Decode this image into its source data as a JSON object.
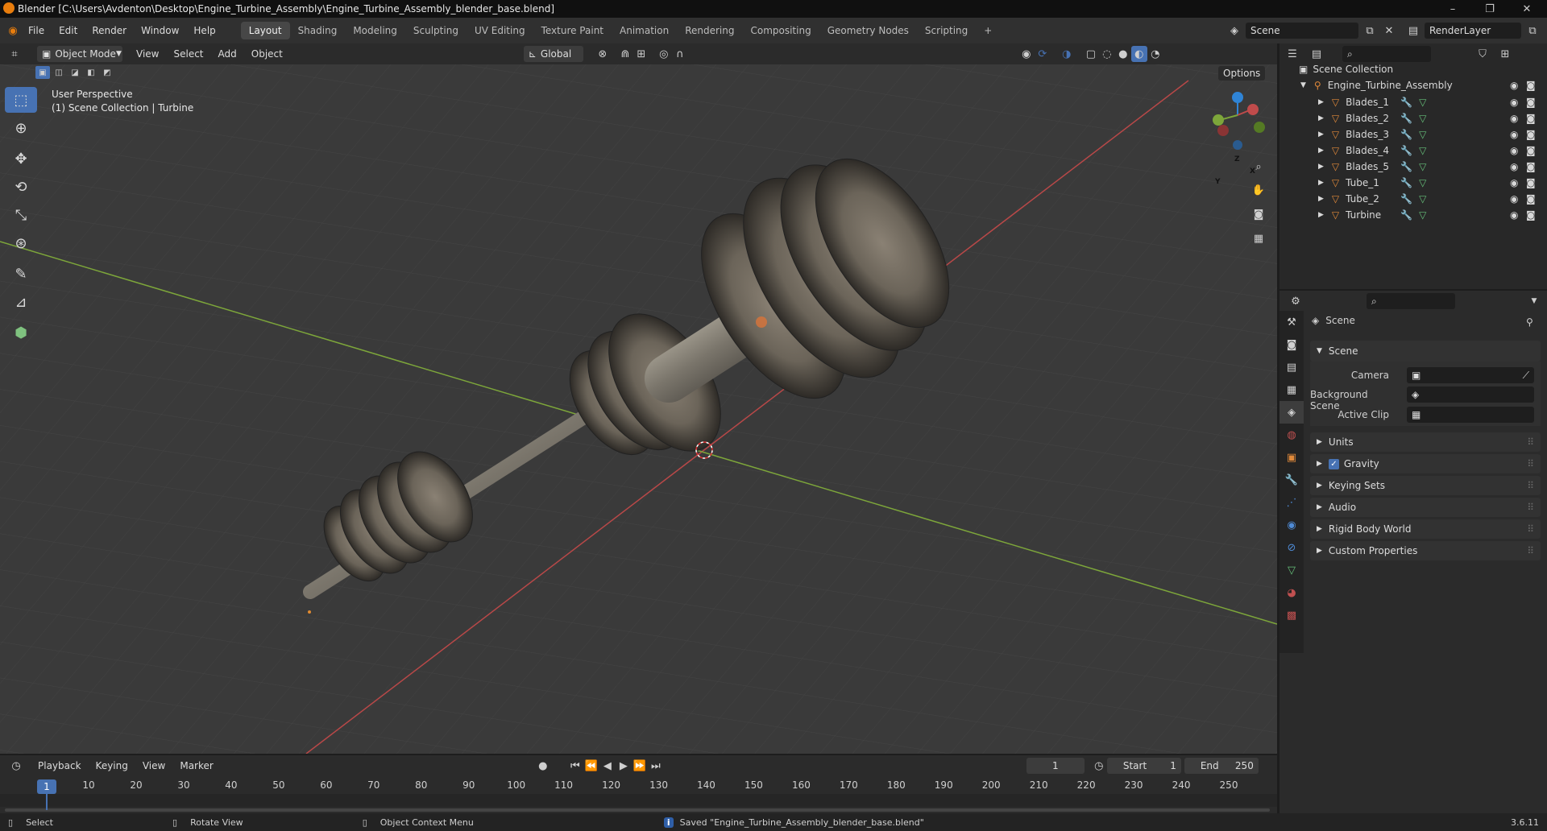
{
  "window": {
    "title": "Blender [C:\\Users\\Avdenton\\Desktop\\Engine_Turbine_Assembly\\Engine_Turbine_Assembly_blender_base.blend]",
    "minimize": "–",
    "maximize": "❐",
    "close": "✕"
  },
  "menu": [
    "File",
    "Edit",
    "Render",
    "Window",
    "Help"
  ],
  "workspaces": [
    "Layout",
    "Shading",
    "Modeling",
    "Sculpting",
    "UV Editing",
    "Texture Paint",
    "Animation",
    "Rendering",
    "Compositing",
    "Geometry Nodes",
    "Scripting"
  ],
  "workspace_add": "+",
  "scene_field": "Scene",
  "renderlayer_field": "RenderLayer",
  "viewport_header": {
    "mode": "Object Mode",
    "menus": [
      "View",
      "Select",
      "Add",
      "Object"
    ],
    "transform": "Global",
    "options": "Options"
  },
  "viewport": {
    "perspective": "User Perspective",
    "collection_info": "(1) Scene Collection | Turbine"
  },
  "gizmo": {
    "z": "Z",
    "x": "X",
    "y": "Y"
  },
  "outliner": {
    "root": "Scene Collection",
    "collection": "Engine_Turbine_Assembly",
    "objects": [
      "Blades_1",
      "Blades_2",
      "Blades_3",
      "Blades_4",
      "Blades_5",
      "Tube_1",
      "Tube_2",
      "Turbine"
    ]
  },
  "properties": {
    "header": "Scene",
    "panel": "Scene",
    "fields": [
      {
        "label": "Camera"
      },
      {
        "label": "Background Scene"
      },
      {
        "label": "Active Clip"
      }
    ],
    "sections": [
      "Units",
      "Gravity",
      "Keying Sets",
      "Audio",
      "Rigid Body World",
      "Custom Properties"
    ],
    "gravity_checked": true
  },
  "timeline": {
    "menus": [
      "Playback",
      "Keying",
      "View",
      "Marker"
    ],
    "current_frame": "1",
    "start_label": "Start",
    "start": "1",
    "end_label": "End",
    "end": "250",
    "ticks": [
      "1",
      "10",
      "20",
      "30",
      "40",
      "50",
      "60",
      "70",
      "80",
      "90",
      "100",
      "110",
      "120",
      "130",
      "140",
      "150",
      "160",
      "170",
      "180",
      "190",
      "200",
      "210",
      "220",
      "230",
      "240",
      "250"
    ]
  },
  "status": {
    "select": "Select",
    "rotate": "Rotate View",
    "context": "Object Context Menu",
    "message": "Saved \"Engine_Turbine_Assembly_blender_base.blend\"",
    "version": "3.6.11"
  },
  "colors": {
    "accent": "#4772b3",
    "x_axis": "#c04b4b",
    "y_axis": "#7da63a",
    "z_axis": "#2f84d6",
    "object_orange": "#e0893a",
    "mesh_green": "#66c07a"
  }
}
